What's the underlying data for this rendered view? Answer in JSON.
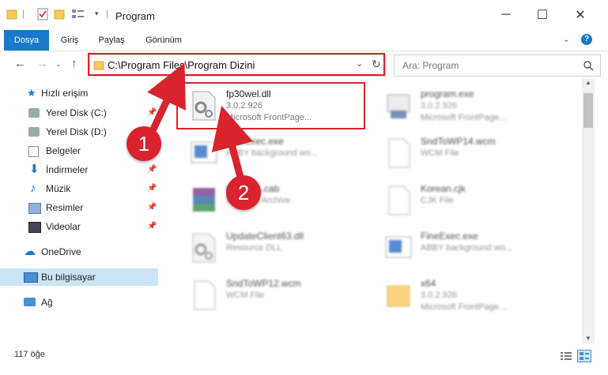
{
  "window": {
    "title": "Program",
    "minimize": "─",
    "maximize": "☐",
    "close": "✕"
  },
  "ribbon": {
    "tabs": [
      "Dosya",
      "Giriş",
      "Paylaş",
      "Görünüm"
    ],
    "help_icon": "?"
  },
  "address": {
    "path": "C:\\Program Files\\Program Dizini",
    "search_placeholder": "Ara: Program"
  },
  "nav": {
    "quick_access": "Hızlı erişim",
    "items": [
      {
        "label": "Yerel Disk (C:)",
        "pinned": true
      },
      {
        "label": "Yerel Disk (D:)",
        "pinned": false
      },
      {
        "label": "Belgeler",
        "pinned": true
      },
      {
        "label": "İndirmeler",
        "pinned": true
      },
      {
        "label": "Müzik",
        "pinned": true
      },
      {
        "label": "Resimler",
        "pinned": true
      },
      {
        "label": "Videolar",
        "pinned": true
      }
    ],
    "onedrive": "OneDrive",
    "this_pc": "Bu bilgisayar",
    "network": "Ağ"
  },
  "files": [
    {
      "name": "fp30wel.dll",
      "line2": "3.0.2.926",
      "line3": "Microsoft FrontPage...",
      "icon": "dll-gear-icon"
    },
    {
      "name": "program.exe",
      "line2": "3.0.2.926",
      "line3": "Microsoft FrontPage...",
      "icon": "exe-icon"
    },
    {
      "name": "FineExec.exe",
      "line2": "ABBY background wo...",
      "line3": "",
      "icon": "app-icon"
    },
    {
      "name": "SndToWP14.wcm",
      "line2": "WCM File",
      "line3": "",
      "icon": "file-icon"
    },
    {
      "name": "Updates.cab",
      "line2": "WinRAR Archive",
      "line3": "",
      "icon": "archive-icon"
    },
    {
      "name": "Korean.cjk",
      "line2": "CJK File",
      "line3": "",
      "icon": "file-icon"
    },
    {
      "name": "UpdateClient63.dll",
      "line2": "Resource DLL",
      "line3": "",
      "icon": "dll-gear-icon"
    },
    {
      "name": "FineExec.exe",
      "line2": "ABBY background wo...",
      "line3": "",
      "icon": "app-icon"
    },
    {
      "name": "SndToWP12.wcm",
      "line2": "WCM File",
      "line3": "",
      "icon": "file-icon"
    },
    {
      "name": "x64",
      "line2": "3.0.2.926",
      "line3": "Microsoft FrontPage...",
      "icon": "folder-icon"
    }
  ],
  "status": {
    "count": "117 öğe"
  },
  "annotations": {
    "step1": "1",
    "step2": "2",
    "accent": "#d9232d"
  }
}
